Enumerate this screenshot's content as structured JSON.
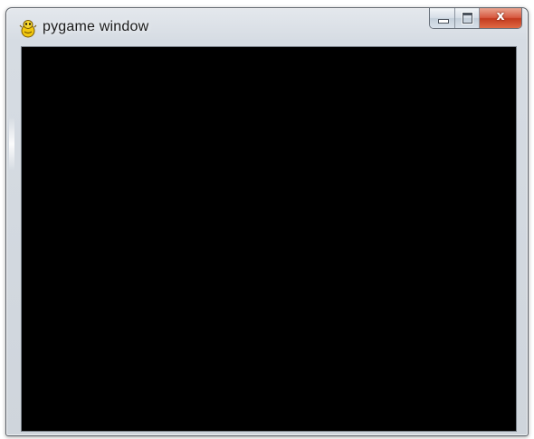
{
  "window": {
    "title": "pygame window",
    "icon": "pygame-snake-icon",
    "client_background": "#000000",
    "controls": {
      "minimize_icon": "minimize-icon",
      "maximize_icon": "maximize-icon",
      "close_label": "x",
      "close_color": "#c8432a"
    }
  }
}
